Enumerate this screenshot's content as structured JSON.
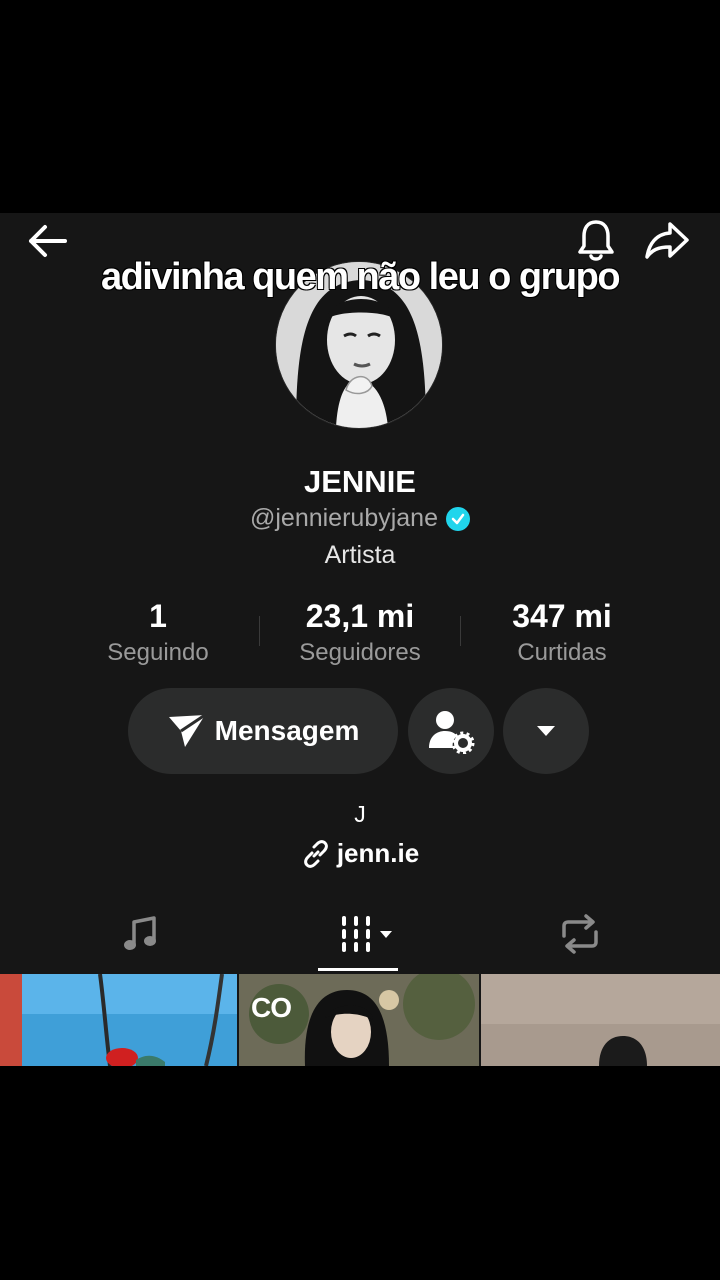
{
  "caption": "adivinha quem não leu o grupo",
  "profile": {
    "name": "JENNIE",
    "handle": "@jennierubyjane",
    "category": "Artista",
    "bio": "J",
    "link": "jenn.ie"
  },
  "stats": [
    {
      "value": "1",
      "label": "Seguindo"
    },
    {
      "value": "23,1 mi",
      "label": "Seguidores"
    },
    {
      "value": "347 mi",
      "label": "Curtidas"
    }
  ],
  "actions": {
    "message_label": "Mensagem"
  },
  "thumbnails": [
    {
      "overlay_text": ""
    },
    {
      "overlay_text": "CO"
    },
    {
      "overlay_text": ""
    }
  ],
  "colors": {
    "background": "#161616",
    "button": "#2b2c2c",
    "verified": "#20d5ec",
    "secondary_text": "#a9a9a9"
  },
  "icons": [
    "back-arrow-icon",
    "bell-icon",
    "share-icon",
    "send-icon",
    "user-settings-icon",
    "chevron-down-icon",
    "link-icon",
    "music-note-icon",
    "grid-icon",
    "repost-icon",
    "verified-badge-icon"
  ]
}
